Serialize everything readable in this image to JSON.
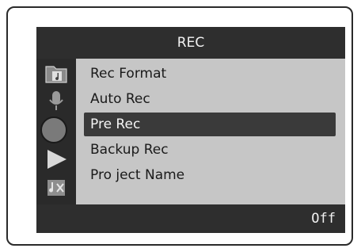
{
  "header": {
    "title": "REC"
  },
  "side_icons": [
    {
      "name": "folder-music-icon"
    },
    {
      "name": "microphone-icon"
    },
    {
      "name": "record-circle-icon"
    },
    {
      "name": "play-triangle-icon"
    },
    {
      "name": "tools-music-icon"
    }
  ],
  "menu": {
    "items": [
      {
        "label": "Rec Format"
      },
      {
        "label": "Auto Rec"
      },
      {
        "label": "Pre Rec"
      },
      {
        "label": "Backup Rec"
      },
      {
        "label": "Pro ject Name"
      }
    ],
    "selected_label": "Pre Rec"
  },
  "status": {
    "value": "Off"
  },
  "colors": {
    "bar": "#2e2e2e",
    "menu_bg": "#c6c6c6",
    "selection": "#3a3a3a"
  }
}
